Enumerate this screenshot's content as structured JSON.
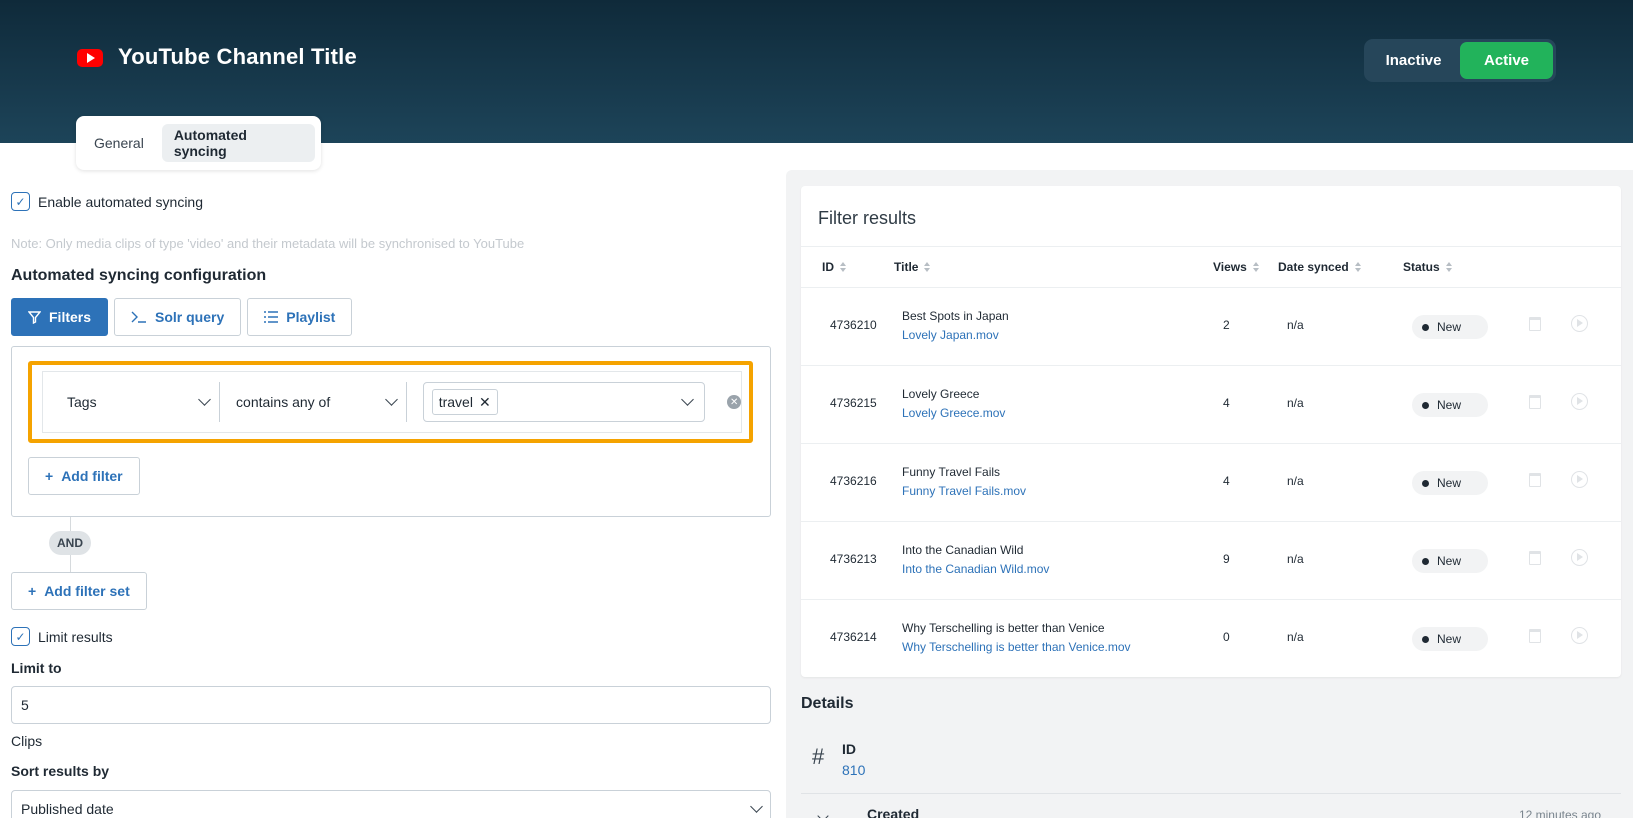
{
  "header": {
    "channel_title": "YouTube Channel Title",
    "toggle": {
      "inactive_label": "Inactive",
      "active_label": "Active",
      "selected": "Active"
    }
  },
  "tabs": [
    {
      "label": "General",
      "selected": false
    },
    {
      "label": "Automated syncing",
      "selected": true
    }
  ],
  "settings": {
    "enable_label": "Enable automated syncing",
    "enable_checked": true,
    "note": "Note: Only media clips of type 'video' and their metadata will be synchronised to YouTube",
    "config_title": "Automated syncing configuration",
    "modes": [
      {
        "label": "Filters",
        "icon": "filter-icon",
        "active": true
      },
      {
        "label": "Solr query",
        "icon": "terminal-icon",
        "active": false
      },
      {
        "label": "Playlist",
        "icon": "list-icon",
        "active": false
      }
    ],
    "filter": {
      "field": "Tags",
      "operator": "contains any of",
      "tags": [
        "travel"
      ]
    },
    "add_filter_label": "Add filter",
    "and_label": "AND",
    "add_filter_set_label": "Add filter set",
    "limit_label": "Limit results",
    "limit_checked": true,
    "limit_to_label": "Limit to",
    "limit_value": "5",
    "limit_unit": "Clips",
    "sort_label": "Sort results by",
    "sort_value": "Published date"
  },
  "results": {
    "title": "Filter results",
    "columns": [
      "ID",
      "Title",
      "Views",
      "Date synced",
      "Status"
    ],
    "rows": [
      {
        "id": "4736210",
        "title": "Best Spots in Japan",
        "file": "Lovely Japan.mov",
        "views": "2",
        "synced": "n/a",
        "status": "New"
      },
      {
        "id": "4736215",
        "title": "Lovely Greece",
        "file": "Lovely Greece.mov",
        "views": "4",
        "synced": "n/a",
        "status": "New"
      },
      {
        "id": "4736216",
        "title": "Funny Travel Fails",
        "file": "Funny Travel Fails.mov",
        "views": "4",
        "synced": "n/a",
        "status": "New"
      },
      {
        "id": "4736213",
        "title": "Into the Canadian Wild",
        "file": "Into the Canadian Wild.mov",
        "views": "9",
        "synced": "n/a",
        "status": "New"
      },
      {
        "id": "4736214",
        "title": "Why Terschelling is better than Venice",
        "file": "Why Terschelling is better than Venice.mov",
        "views": "0",
        "synced": "n/a",
        "status": "New"
      }
    ]
  },
  "details": {
    "title": "Details",
    "id_label": "ID",
    "id_value": "810",
    "created_label": "Created",
    "created_value": "12 minutes ago"
  },
  "colors": {
    "accent": "#2d72b8",
    "active": "#22b35b",
    "highlight": "#f5a300",
    "header": "#0f2a3a"
  }
}
